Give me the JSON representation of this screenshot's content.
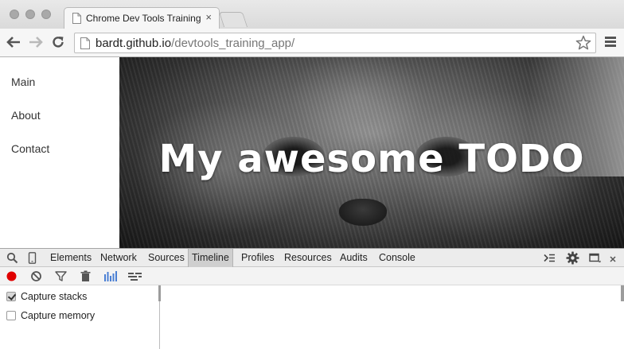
{
  "browser": {
    "tab_title": "Chrome Dev Tools Training",
    "tab_close": "×",
    "url_host": "bardt.github.io",
    "url_path": "/devtools_training_app/"
  },
  "page": {
    "nav": [
      {
        "label": "Main"
      },
      {
        "label": "About"
      },
      {
        "label": "Contact"
      }
    ],
    "hero_title": "My awesome TODO"
  },
  "devtools": {
    "tabs": [
      {
        "label": "Elements"
      },
      {
        "label": "Network"
      },
      {
        "label": "Sources"
      },
      {
        "label": "Timeline",
        "selected": true
      },
      {
        "label": "Profiles"
      },
      {
        "label": "Resources"
      },
      {
        "label": "Audits"
      },
      {
        "label": "Console"
      }
    ],
    "options": [
      {
        "label": "Capture stacks",
        "checked": true
      },
      {
        "label": "Capture memory",
        "checked": false
      }
    ],
    "record_color": "#e00000",
    "chart_icon_color": "#4a7fd4"
  }
}
